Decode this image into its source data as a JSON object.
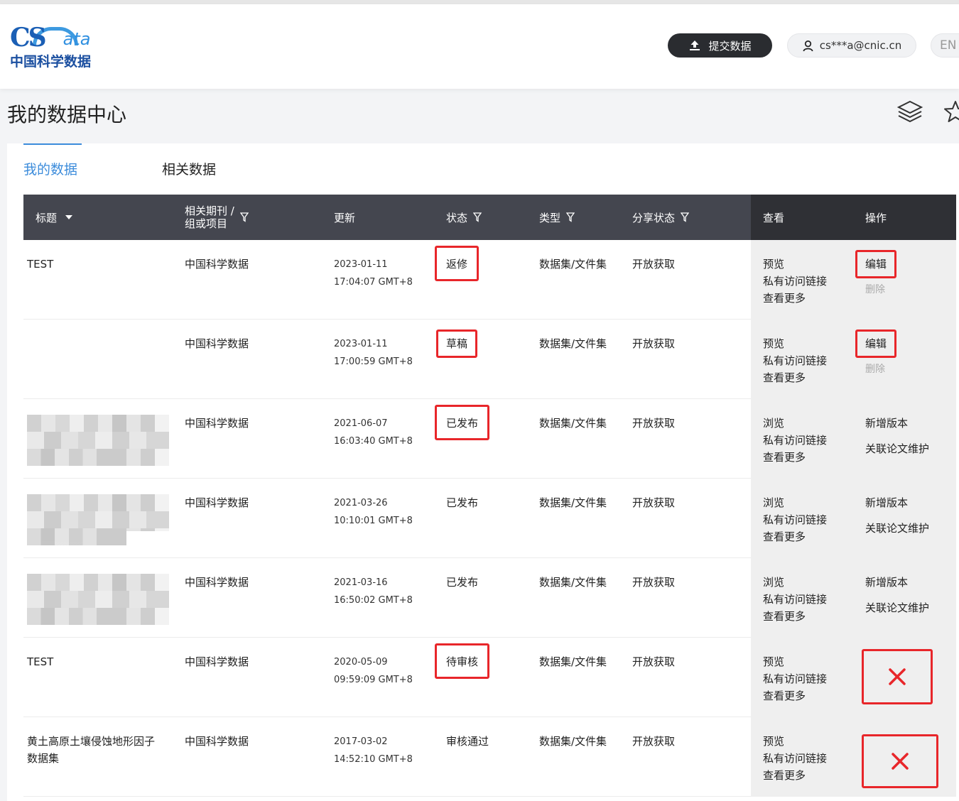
{
  "brand": {
    "logo_cs": "CS",
    "logo_ata": "ata",
    "logo_cn": "中国科学数据"
  },
  "header": {
    "submit_label": "提交数据",
    "user_email": "cs***a@cnic.cn",
    "lang": "EN"
  },
  "page": {
    "title": "我的数据中心"
  },
  "tabs": [
    {
      "label": "我的数据"
    },
    {
      "label": "相关数据"
    }
  ],
  "columns": {
    "title": "标题",
    "journal_line1": "相关期刊 /",
    "journal_line2": "组或项目",
    "update": "更新",
    "status": "状态",
    "type": "类型",
    "share": "分享状态",
    "view": "查看",
    "op": "操作"
  },
  "rows": [
    {
      "title": "TEST",
      "journal": "中国科学数据",
      "date": "2023-01-11",
      "time": "17:04:07 GMT+8",
      "status": "返修",
      "type": "数据集/文件集",
      "share": "开放获取",
      "view1": "预览",
      "view2": "私有访问链接",
      "view3": "查看更多",
      "op1": "编辑",
      "op2": "删除"
    },
    {
      "title": "",
      "journal": "中国科学数据",
      "date": "2023-01-11",
      "time": "17:00:59 GMT+8",
      "status": "草稿",
      "type": "数据集/文件集",
      "share": "开放获取",
      "view1": "预览",
      "view2": "私有访问链接",
      "view3": "查看更多",
      "op1": "编辑",
      "op2": "删除"
    },
    {
      "title": "",
      "journal": "中国科学数据",
      "date": "2021-06-07",
      "time": "16:03:40 GMT+8",
      "status": "已发布",
      "type": "数据集/文件集",
      "share": "开放获取",
      "view1": "浏览",
      "view2": "私有访问链接",
      "view3": "查看更多",
      "op1": "新增版本",
      "op2": "关联论文维护"
    },
    {
      "title": "",
      "journal": "中国科学数据",
      "date": "2021-03-26",
      "time": "10:10:01 GMT+8",
      "status": "已发布",
      "type": "数据集/文件集",
      "share": "开放获取",
      "view1": "浏览",
      "view2": "私有访问链接",
      "view3": "查看更多",
      "op1": "新增版本",
      "op2": "关联论文维护"
    },
    {
      "title": "",
      "journal": "中国科学数据",
      "date": "2021-03-16",
      "time": "16:50:02 GMT+8",
      "status": "已发布",
      "type": "数据集/文件集",
      "share": "开放获取",
      "view1": "浏览",
      "view2": "私有访问链接",
      "view3": "查看更多",
      "op1": "新增版本",
      "op2": "关联论文维护"
    },
    {
      "title": "TEST",
      "journal": "中国科学数据",
      "date": "2020-05-09",
      "time": "09:59:09 GMT+8",
      "status": "待审核",
      "type": "数据集/文件集",
      "share": "开放获取",
      "view1": "预览",
      "view2": "私有访问链接",
      "view3": "查看更多"
    },
    {
      "title": "黄土高原土壤侵蚀地形因子数据集",
      "journal": "中国科学数据",
      "date": "2017-03-02",
      "time": "14:52:10 GMT+8",
      "status": "审核通过",
      "type": "数据集/文件集",
      "share": "开放获取",
      "view1": "预览",
      "view2": "私有访问链接",
      "view3": "查看更多"
    }
  ],
  "colors": {
    "accent": "#3c8cdb",
    "highlight": "#e8262a",
    "header_dark": "#44464f"
  }
}
